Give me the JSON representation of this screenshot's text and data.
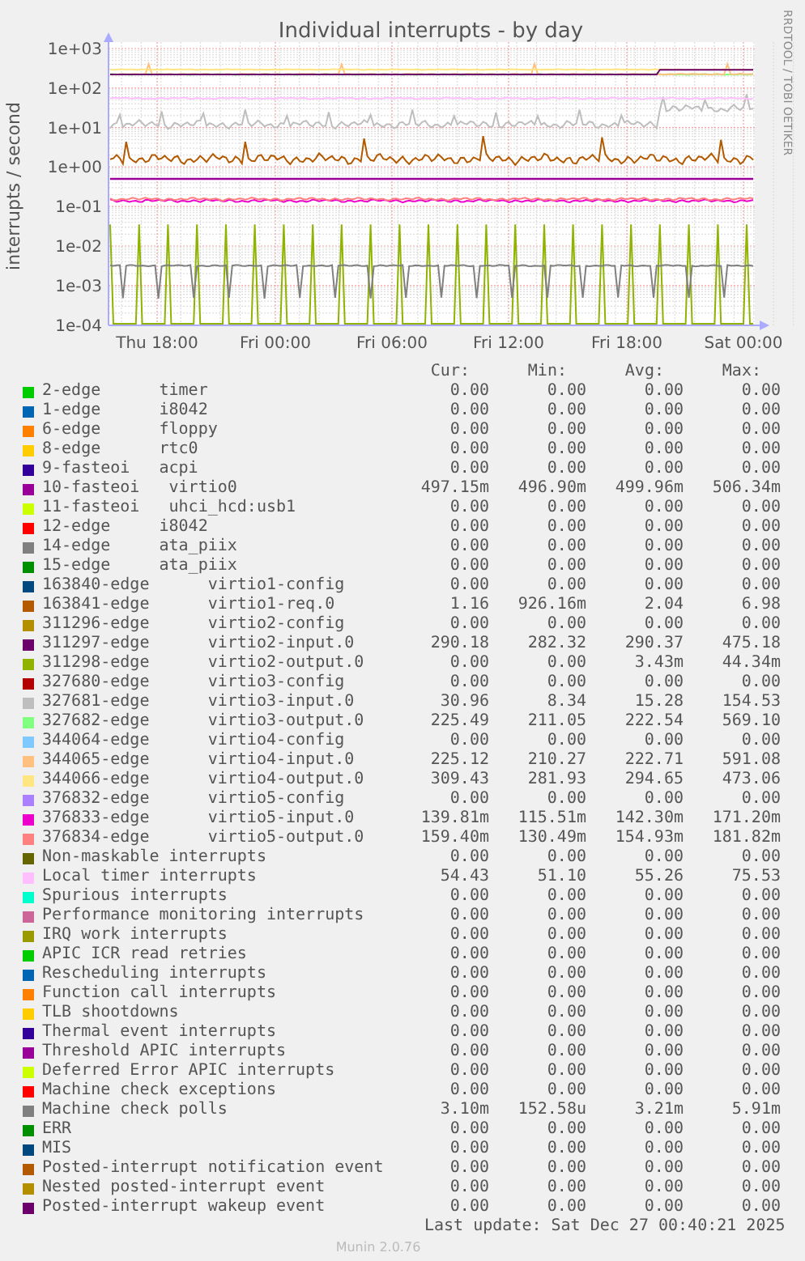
{
  "graph": {
    "title": "Individual interrupts - by day",
    "y_axis_label": "interrupts / second",
    "side_text": "RRDTOOL / TOBI OETIKER",
    "y_ticks": [
      "1e+03",
      "1e+02",
      "1e+01",
      "1e+00",
      "1e-01",
      "1e-02",
      "1e-03",
      "1e-04"
    ],
    "x_ticks": [
      "Thu 18:00",
      "Fri 00:00",
      "Fri 06:00",
      "Fri 12:00",
      "Fri 18:00",
      "Sat 00:00"
    ]
  },
  "legend": {
    "columns": [
      "Cur:",
      "Min:",
      "Avg:",
      "Max:"
    ],
    "rows": [
      {
        "name": "2-edge",
        "label": "timer",
        "color": "#00cc00",
        "values": [
          "0.00",
          "0.00",
          "0.00",
          "0.00"
        ]
      },
      {
        "name": "1-edge",
        "label": "i8042",
        "color": "#0066b3",
        "values": [
          "0.00",
          "0.00",
          "0.00",
          "0.00"
        ]
      },
      {
        "name": "6-edge",
        "label": "floppy",
        "color": "#ff8000",
        "values": [
          "0.00",
          "0.00",
          "0.00",
          "0.00"
        ]
      },
      {
        "name": "8-edge",
        "label": "rtc0",
        "color": "#ffcc00",
        "values": [
          "0.00",
          "0.00",
          "0.00",
          "0.00"
        ]
      },
      {
        "name": "9-fasteoi",
        "label": "acpi",
        "color": "#330099",
        "values": [
          "0.00",
          "0.00",
          "0.00",
          "0.00"
        ]
      },
      {
        "name": "10-fasteoi",
        "label": "virtio0",
        "color": "#990099",
        "values": [
          "497.15m",
          "496.90m",
          "499.96m",
          "506.34m"
        ]
      },
      {
        "name": "11-fasteoi",
        "label": "uhci_hcd:usb1",
        "color": "#ccff00",
        "values": [
          "0.00",
          "0.00",
          "0.00",
          "0.00"
        ]
      },
      {
        "name": "12-edge",
        "label": "i8042",
        "color": "#ff0000",
        "values": [
          "0.00",
          "0.00",
          "0.00",
          "0.00"
        ]
      },
      {
        "name": "14-edge",
        "label": "ata_piix",
        "color": "#808080",
        "values": [
          "0.00",
          "0.00",
          "0.00",
          "0.00"
        ]
      },
      {
        "name": "15-edge",
        "label": "ata_piix",
        "color": "#008f00",
        "values": [
          "0.00",
          "0.00",
          "0.00",
          "0.00"
        ]
      },
      {
        "name": "163840-edge",
        "label": "virtio1-config",
        "color": "#00487d",
        "values": [
          "0.00",
          "0.00",
          "0.00",
          "0.00"
        ]
      },
      {
        "name": "163841-edge",
        "label": "virtio1-req.0",
        "color": "#b35a00",
        "values": [
          "1.16",
          "926.16m",
          "2.04",
          "6.98"
        ]
      },
      {
        "name": "311296-edge",
        "label": "virtio2-config",
        "color": "#b38f00",
        "values": [
          "0.00",
          "0.00",
          "0.00",
          "0.00"
        ]
      },
      {
        "name": "311297-edge",
        "label": "virtio2-input.0",
        "color": "#6b006b",
        "values": [
          "290.18",
          "282.32",
          "290.37",
          "475.18"
        ]
      },
      {
        "name": "311298-edge",
        "label": "virtio2-output.0",
        "color": "#8fb300",
        "values": [
          "0.00",
          "0.00",
          "3.43m",
          "44.34m"
        ]
      },
      {
        "name": "327680-edge",
        "label": "virtio3-config",
        "color": "#b30000",
        "values": [
          "0.00",
          "0.00",
          "0.00",
          "0.00"
        ]
      },
      {
        "name": "327681-edge",
        "label": "virtio3-input.0",
        "color": "#bebebe",
        "values": [
          "30.96",
          "8.34",
          "15.28",
          "154.53"
        ]
      },
      {
        "name": "327682-edge",
        "label": "virtio3-output.0",
        "color": "#80ff80",
        "values": [
          "225.49",
          "211.05",
          "222.54",
          "569.10"
        ]
      },
      {
        "name": "344064-edge",
        "label": "virtio4-config",
        "color": "#80c9ff",
        "values": [
          "0.00",
          "0.00",
          "0.00",
          "0.00"
        ]
      },
      {
        "name": "344065-edge",
        "label": "virtio4-input.0",
        "color": "#ffc080",
        "values": [
          "225.12",
          "210.27",
          "222.71",
          "591.08"
        ]
      },
      {
        "name": "344066-edge",
        "label": "virtio4-output.0",
        "color": "#ffe680",
        "values": [
          "309.43",
          "281.93",
          "294.65",
          "473.06"
        ]
      },
      {
        "name": "376832-edge",
        "label": "virtio5-config",
        "color": "#aa80ff",
        "values": [
          "0.00",
          "0.00",
          "0.00",
          "0.00"
        ]
      },
      {
        "name": "376833-edge",
        "label": "virtio5-input.0",
        "color": "#ee00cc",
        "values": [
          "139.81m",
          "115.51m",
          "142.30m",
          "171.20m"
        ]
      },
      {
        "name": "376834-edge",
        "label": "virtio5-output.0",
        "color": "#ff8080",
        "values": [
          "159.40m",
          "130.49m",
          "154.93m",
          "181.82m"
        ]
      },
      {
        "name": "Non-maskable interrupts",
        "color": "#666600",
        "values": [
          "0.00",
          "0.00",
          "0.00",
          "0.00"
        ]
      },
      {
        "name": "Local timer interrupts",
        "color": "#ffbfff",
        "values": [
          "54.43",
          "51.10",
          "55.26",
          "75.53"
        ]
      },
      {
        "name": "Spurious interrupts",
        "color": "#00ffcc",
        "values": [
          "0.00",
          "0.00",
          "0.00",
          "0.00"
        ]
      },
      {
        "name": "Performance monitoring interrupts",
        "color": "#cc6699",
        "values": [
          "0.00",
          "0.00",
          "0.00",
          "0.00"
        ]
      },
      {
        "name": "IRQ work interrupts",
        "color": "#999900",
        "values": [
          "0.00",
          "0.00",
          "0.00",
          "0.00"
        ]
      },
      {
        "name": "APIC ICR read retries",
        "color": "#00cc00",
        "values": [
          "0.00",
          "0.00",
          "0.00",
          "0.00"
        ]
      },
      {
        "name": "Rescheduling interrupts",
        "color": "#0066b3",
        "values": [
          "0.00",
          "0.00",
          "0.00",
          "0.00"
        ]
      },
      {
        "name": "Function call interrupts",
        "color": "#ff8000",
        "values": [
          "0.00",
          "0.00",
          "0.00",
          "0.00"
        ]
      },
      {
        "name": "TLB shootdowns",
        "color": "#ffcc00",
        "values": [
          "0.00",
          "0.00",
          "0.00",
          "0.00"
        ]
      },
      {
        "name": "Thermal event interrupts",
        "color": "#330099",
        "values": [
          "0.00",
          "0.00",
          "0.00",
          "0.00"
        ]
      },
      {
        "name": "Threshold APIC interrupts",
        "color": "#990099",
        "values": [
          "0.00",
          "0.00",
          "0.00",
          "0.00"
        ]
      },
      {
        "name": "Deferred Error APIC interrupts",
        "color": "#ccff00",
        "values": [
          "0.00",
          "0.00",
          "0.00",
          "0.00"
        ]
      },
      {
        "name": "Machine check exceptions",
        "color": "#ff0000",
        "values": [
          "0.00",
          "0.00",
          "0.00",
          "0.00"
        ]
      },
      {
        "name": "Machine check polls",
        "color": "#808080",
        "values": [
          "3.10m",
          "152.58u",
          "3.21m",
          "5.91m"
        ]
      },
      {
        "name": "ERR",
        "color": "#008f00",
        "values": [
          "0.00",
          "0.00",
          "0.00",
          "0.00"
        ]
      },
      {
        "name": "MIS",
        "color": "#00487d",
        "values": [
          "0.00",
          "0.00",
          "0.00",
          "0.00"
        ]
      },
      {
        "name": "Posted-interrupt notification event",
        "color": "#b35a00",
        "values": [
          "0.00",
          "0.00",
          "0.00",
          "0.00"
        ]
      },
      {
        "name": "Nested posted-interrupt event",
        "color": "#b38f00",
        "values": [
          "0.00",
          "0.00",
          "0.00",
          "0.00"
        ]
      },
      {
        "name": "Posted-interrupt wakeup event",
        "color": "#6b006b",
        "values": [
          "0.00",
          "0.00",
          "0.00",
          "0.00"
        ]
      }
    ]
  },
  "last_update": "Last update: Sat Dec 27 00:40:21 2025",
  "footer": "Munin 2.0.76"
}
